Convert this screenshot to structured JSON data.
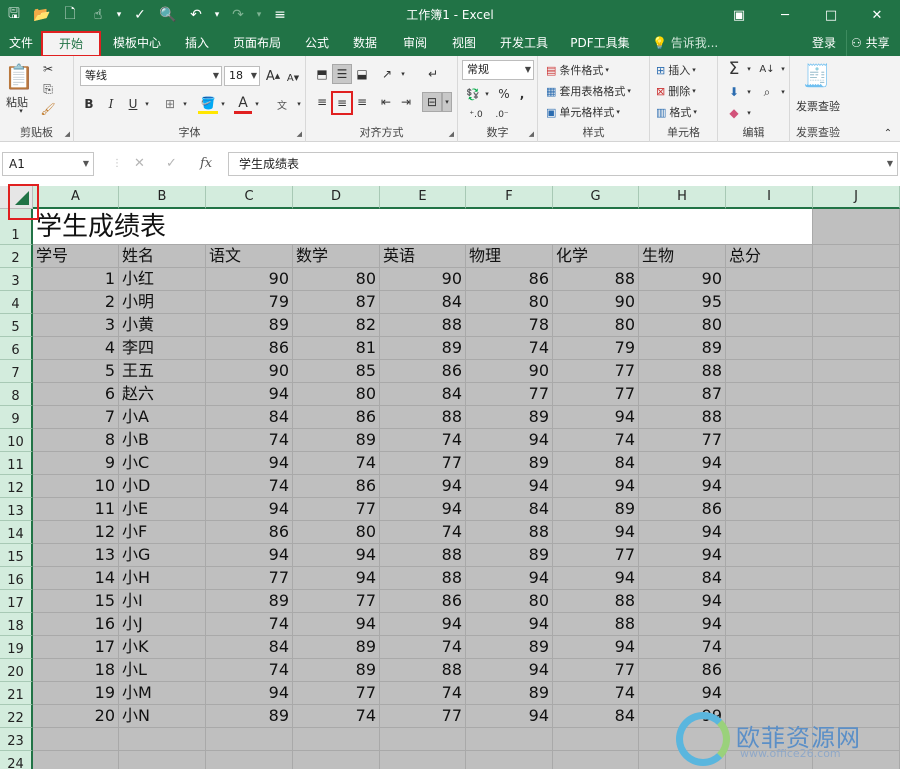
{
  "window": {
    "title": "工作簿1 - Excel",
    "quick_access": [
      "save-icon",
      "open-icon",
      "new-icon",
      "touch-icon",
      "spellcheck-icon",
      "print-preview-icon",
      "undo-icon",
      "redo-icon",
      "customize-icon"
    ],
    "controls": {
      "ribbon_options": "▣",
      "minimize": "─",
      "maximize": "□",
      "close": "✕"
    }
  },
  "tabs": [
    {
      "label": "文件"
    },
    {
      "label": "开始"
    },
    {
      "label": "模板中心"
    },
    {
      "label": "插入"
    },
    {
      "label": "页面布局"
    },
    {
      "label": "公式"
    },
    {
      "label": "数据"
    },
    {
      "label": "审阅"
    },
    {
      "label": "视图"
    },
    {
      "label": "开发工具"
    },
    {
      "label": "PDF工具集"
    }
  ],
  "tab_active": "开始",
  "tell_me": "告诉我...",
  "login": "登录",
  "share": "共享",
  "ribbon": {
    "clipboard": {
      "paste": "粘贴",
      "label": "剪贴板"
    },
    "font": {
      "name": "等线",
      "size": "18",
      "grow": "A",
      "shrink": "A",
      "bold": "B",
      "italic": "I",
      "underline": "U",
      "font_color": "A",
      "label": "字体"
    },
    "alignment": {
      "label": "对齐方式"
    },
    "number": {
      "format": "常规",
      "percent": "%",
      "comma": ",",
      "label": "数字"
    },
    "styles": {
      "conditional": "条件格式",
      "table": "套用表格格式",
      "cell": "单元格样式",
      "label": "样式"
    },
    "cells": {
      "insert": "插入",
      "delete": "删除",
      "format": "格式",
      "label": "单元格"
    },
    "editing": {
      "label": "编辑"
    },
    "invoice": {
      "button": "发票查验",
      "label": "发票查验"
    }
  },
  "formula_bar": {
    "name_box": "A1",
    "cancel": "✕",
    "enter": "✓",
    "fx": "fx",
    "content": "学生成绩表"
  },
  "columns": [
    "A",
    "B",
    "C",
    "D",
    "E",
    "F",
    "G",
    "H",
    "I",
    "J"
  ],
  "rows": [
    "1",
    "2",
    "3",
    "4",
    "5",
    "6",
    "7",
    "8",
    "9",
    "10",
    "11",
    "12",
    "13",
    "14",
    "15",
    "16",
    "17",
    "18",
    "19",
    "20",
    "21",
    "22",
    "23",
    "24"
  ],
  "sheet": {
    "title": "学生成绩表",
    "headers": [
      "学号",
      "姓名",
      "语文",
      "数学",
      "英语",
      "物理",
      "化学",
      "生物",
      "总分"
    ],
    "records": [
      [
        "1",
        "小红",
        "90",
        "80",
        "90",
        "86",
        "88",
        "90"
      ],
      [
        "2",
        "小明",
        "79",
        "87",
        "84",
        "80",
        "90",
        "95"
      ],
      [
        "3",
        "小黄",
        "89",
        "82",
        "88",
        "78",
        "80",
        "80"
      ],
      [
        "4",
        "李四",
        "86",
        "81",
        "89",
        "74",
        "79",
        "89"
      ],
      [
        "5",
        "王五",
        "90",
        "85",
        "86",
        "90",
        "77",
        "88"
      ],
      [
        "6",
        "赵六",
        "94",
        "80",
        "84",
        "77",
        "77",
        "87"
      ],
      [
        "7",
        "小A",
        "84",
        "86",
        "88",
        "89",
        "94",
        "88"
      ],
      [
        "8",
        "小B",
        "74",
        "89",
        "74",
        "94",
        "74",
        "77"
      ],
      [
        "9",
        "小C",
        "94",
        "74",
        "77",
        "89",
        "84",
        "94"
      ],
      [
        "10",
        "小D",
        "74",
        "86",
        "94",
        "94",
        "94",
        "94"
      ],
      [
        "11",
        "小E",
        "94",
        "77",
        "94",
        "84",
        "89",
        "86"
      ],
      [
        "12",
        "小F",
        "86",
        "80",
        "74",
        "88",
        "94",
        "94"
      ],
      [
        "13",
        "小G",
        "94",
        "94",
        "88",
        "89",
        "77",
        "94"
      ],
      [
        "14",
        "小H",
        "77",
        "94",
        "88",
        "94",
        "94",
        "84"
      ],
      [
        "15",
        "小I",
        "89",
        "77",
        "86",
        "80",
        "88",
        "94"
      ],
      [
        "16",
        "小J",
        "74",
        "94",
        "94",
        "94",
        "88",
        "94"
      ],
      [
        "17",
        "小K",
        "84",
        "89",
        "74",
        "89",
        "94",
        "74"
      ],
      [
        "18",
        "小L",
        "74",
        "89",
        "88",
        "94",
        "77",
        "86"
      ],
      [
        "19",
        "小M",
        "94",
        "77",
        "74",
        "89",
        "74",
        "94"
      ],
      [
        "20",
        "小N",
        "89",
        "74",
        "77",
        "94",
        "84",
        "99"
      ]
    ]
  },
  "watermark": {
    "name": "欧菲资源网",
    "url": "www.office26.com"
  }
}
